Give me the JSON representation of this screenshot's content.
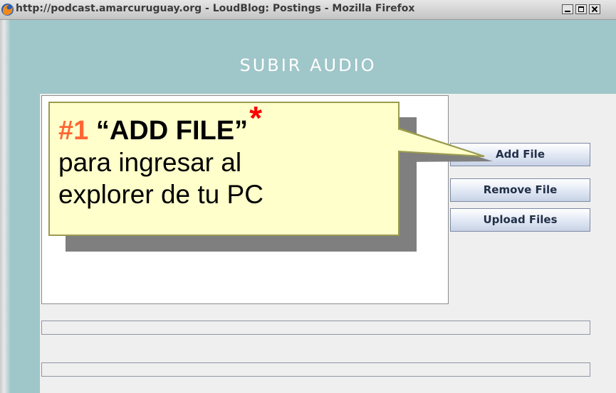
{
  "window": {
    "title": "http://podcast.amarcuruguay.org - LoudBlog: Postings - Mozilla Firefox",
    "icon": "firefox-icon"
  },
  "page": {
    "heading": "SUBIR AUDIO"
  },
  "uploader": {
    "add_label": "Add File",
    "remove_label": "Remove File",
    "upload_label": "Upload Files",
    "progress_1": 0,
    "progress_2": 0
  },
  "callout": {
    "step": "#1",
    "title": "“ADD FILE”",
    "asterisk": "*",
    "line2": "para ingresar al",
    "line3": "explorer de tu PC"
  },
  "colors": {
    "page_background": "#9fc6c9",
    "callout_background": "#ffffcb",
    "step_color": "#ff6633",
    "asterisk_color": "#ff0000"
  }
}
